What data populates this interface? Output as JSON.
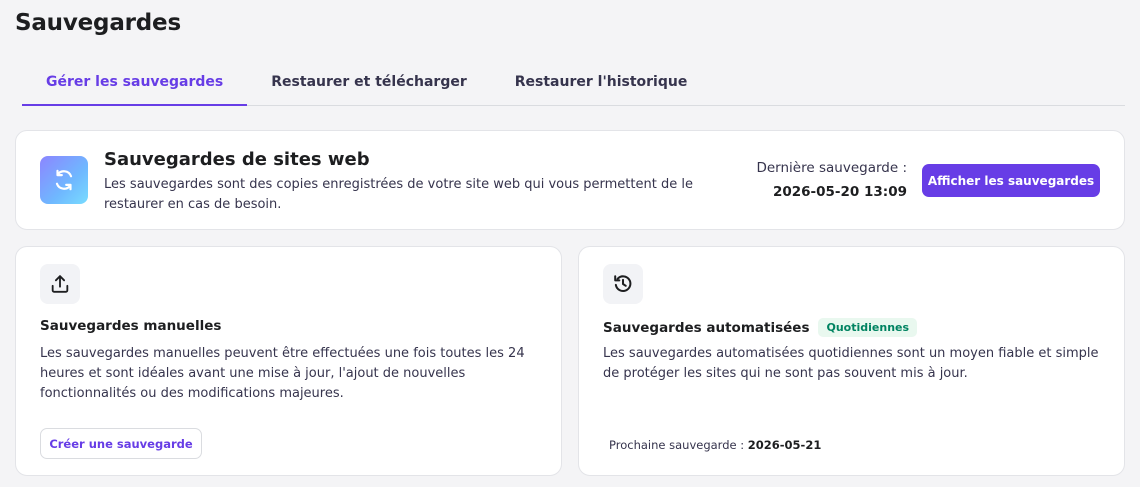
{
  "page": {
    "title": "Sauvegardes"
  },
  "tabs": [
    {
      "label": "Gérer les sauvegardes",
      "active": true
    },
    {
      "label": "Restaurer et télécharger",
      "active": false
    },
    {
      "label": "Restaurer l'historique",
      "active": false
    }
  ],
  "overview": {
    "icon": "refresh-icon",
    "title": "Sauvegardes de sites web",
    "description": "Les sauvegardes sont des copies enregistrées de votre site web qui vous permettent de le restaurer en cas de besoin.",
    "last_backup_label": "Dernière sauvegarde :",
    "last_backup_value": "2026-05-20 13:09",
    "view_button": "Afficher les sauvegardes"
  },
  "manual": {
    "icon": "upload-icon",
    "title": "Sauvegardes manuelles",
    "description": "Les sauvegardes manuelles peuvent être effectuées une fois toutes les 24 heures et sont idéales avant une mise à jour, l'ajout de nouvelles fonctionnalités ou des modifications majeures.",
    "create_button": "Créer une sauvegarde"
  },
  "automated": {
    "icon": "history-icon",
    "title": "Sauvegardes automatisées",
    "badge": "Quotidiennes",
    "description": "Les sauvegardes automatisées quotidiennes sont un moyen fiable et simple de protéger les sites qui ne sont pas souvent mis à jour.",
    "next_backup_label": "Prochaine sauvegarde :",
    "next_backup_value": "2026-05-21"
  },
  "colors": {
    "accent": "#673de6",
    "badge_bg": "#e9f8ef",
    "badge_text": "#008361"
  }
}
